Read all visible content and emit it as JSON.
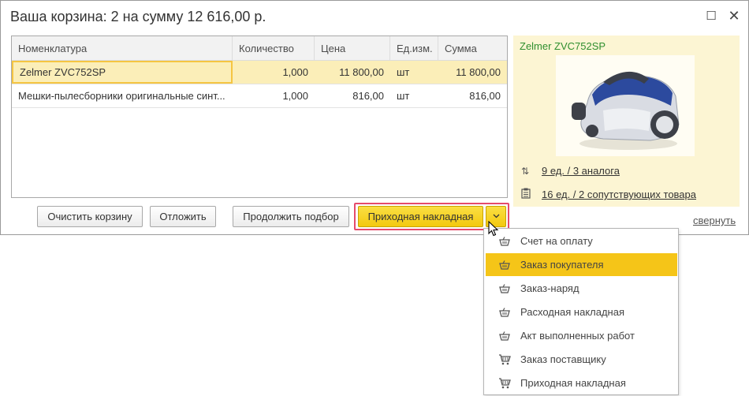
{
  "window": {
    "title": "Ваша корзина:  2 на сумму 12 616,00 р.",
    "maximize_icon": "maximize-icon",
    "close_icon": "close-icon"
  },
  "table": {
    "columns": [
      "Номенклатура",
      "Количество",
      "Цена",
      "Ед.изм.",
      "Сумма"
    ],
    "rows": [
      {
        "name": "Zelmer ZVC752SP",
        "qty": "1,000",
        "price": "11 800,00",
        "unit": "шт",
        "sum": "11 800,00"
      },
      {
        "name": "Мешки-пылесборники оригинальные синт...",
        "qty": "1,000",
        "price": "816,00",
        "unit": "шт",
        "sum": "816,00"
      }
    ]
  },
  "buttons": {
    "clear": "Очистить корзину",
    "defer": "Отложить",
    "continue": "Продолжить подбор",
    "main": "Приходная накладная",
    "dropdown_icon": "chevron-down-icon"
  },
  "panel": {
    "title": "Zelmer ZVC752SP",
    "analogs_link": "9 ед. / 3 аналога",
    "related_link": "16 ед. / 2 сопутствующих товара",
    "collapse": "свернуть"
  },
  "menu": {
    "items": [
      {
        "label": "Счет на оплату",
        "icon": "basket-icon"
      },
      {
        "label": "Заказ покупателя",
        "icon": "basket-icon",
        "active": true
      },
      {
        "label": "Заказ-наряд",
        "icon": "basket-icon"
      },
      {
        "label": "Расходная накладная",
        "icon": "basket-icon"
      },
      {
        "label": "Акт выполненных работ",
        "icon": "basket-icon"
      },
      {
        "label": "Заказ поставщику",
        "icon": "cart-icon"
      },
      {
        "label": "Приходная накладная",
        "icon": "cart-icon"
      }
    ]
  },
  "colors": {
    "accent_yellow": "#f5c518",
    "selection": "#fbeeb8",
    "panel_bg": "#fcf5d3",
    "title_green": "#2f8f2f",
    "highlight_frame": "#e54b6b"
  }
}
